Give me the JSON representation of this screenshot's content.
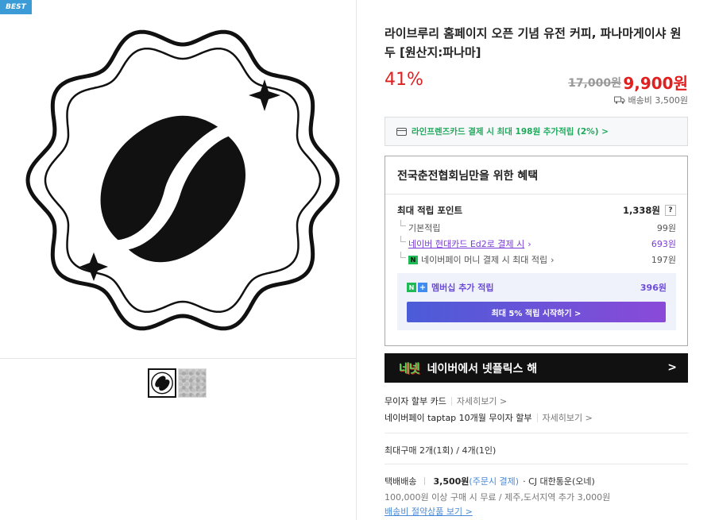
{
  "gallery": {
    "badge": "BEST",
    "main_image_icon": "coffee-bean-badge-icon"
  },
  "product": {
    "title": "라이브루리 홈페이지 오픈 기념 유전 커피, 파나마게이샤 원두 [원산지:파나마]",
    "discount": "41%",
    "original_price": "17,000원",
    "price": "9,900원",
    "shipping_fee": "배송비 3,500원"
  },
  "card_banner": {
    "text": "라인프렌즈카드 결제 시 최대 198원 추가적립 (2%) >"
  },
  "benefit": {
    "title": "전국춘전협회님만을 위한 혜택",
    "max_points_label": "최대 적립 포인트",
    "max_points_value": "1,338원",
    "help": "?",
    "rows": [
      {
        "label": "기본적립",
        "value": "99원"
      },
      {
        "label": "네이버 현대카드 Ed2로 결제 시",
        "value": "693원"
      },
      {
        "label": "네이버페이 머니 결제 시 최대 적립",
        "value": "197원"
      }
    ],
    "membership_label": "멤버십 추가 적립",
    "membership_value": "396원",
    "membership_button": "최대 5% 적립 시작하기 >"
  },
  "netflix": {
    "logo": "네넷",
    "text": "네이버에서 넷플릭스 해",
    "chevron": ">"
  },
  "installment": [
    {
      "label": "무이자 할부 카드",
      "more": "자세히보기 >"
    },
    {
      "label": "네이버페이 taptap 10개월 무이자 할부",
      "more": "자세히보기 >"
    }
  ],
  "purchase_limit": "최대구매 2개(1회) / 4개(1인)",
  "delivery": {
    "type": "택배배송",
    "fee": "3,500원",
    "fee_note": "(주문시 결제)",
    "courier": "· CJ 대한통운(오네)",
    "free_condition": "100,000원 이상 구매 시 무료 / 제주,도서지역 추가 3,000원",
    "saving_link": "배송비 절약상품 보기 >"
  },
  "colors": {
    "accent_red": "#e02020",
    "green": "#1fa95c",
    "purple": "#7a3cd6",
    "badge_blue": "#3b9bd6"
  }
}
